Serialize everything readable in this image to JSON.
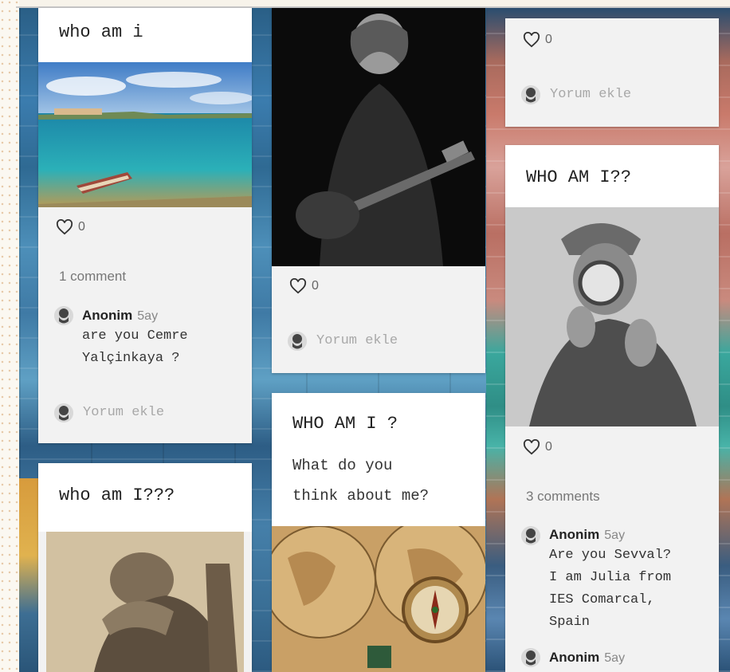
{
  "cards": {
    "c1": {
      "title": "who am i",
      "likes": "0",
      "comments_count": "1 comment",
      "comments": [
        {
          "author": "Anonim",
          "time": "5ay",
          "text": "are you Cemre\nYalçinkaya ?"
        }
      ],
      "add_comment": "Yorum ekle"
    },
    "c2": {
      "likes": "0",
      "add_comment": "Yorum ekle"
    },
    "c3": {
      "likes": "0",
      "add_comment": "Yorum ekle"
    },
    "c4": {
      "title": "WHO AM I??",
      "likes": "0",
      "comments_count": "3 comments",
      "comments": [
        {
          "author": "Anonim",
          "time": "5ay",
          "text": "Are you Sevval?\nI am Julia from\nIES Comarcal,\nSpain"
        },
        {
          "author": "Anonim",
          "time": "5ay",
          "text": ""
        }
      ]
    },
    "c5": {
      "title": "who am I???"
    },
    "c6": {
      "title": "WHO AM I ?",
      "body_line1": "What do you",
      "body_line2": "think about me?"
    }
  },
  "icons": {
    "like": "heart-icon",
    "avatar": "anonymous-avatar-icon"
  },
  "colors": {
    "card_bg": "#f2f2f2",
    "card_head_bg": "#ffffff",
    "muted_text": "#a8a8a8"
  }
}
